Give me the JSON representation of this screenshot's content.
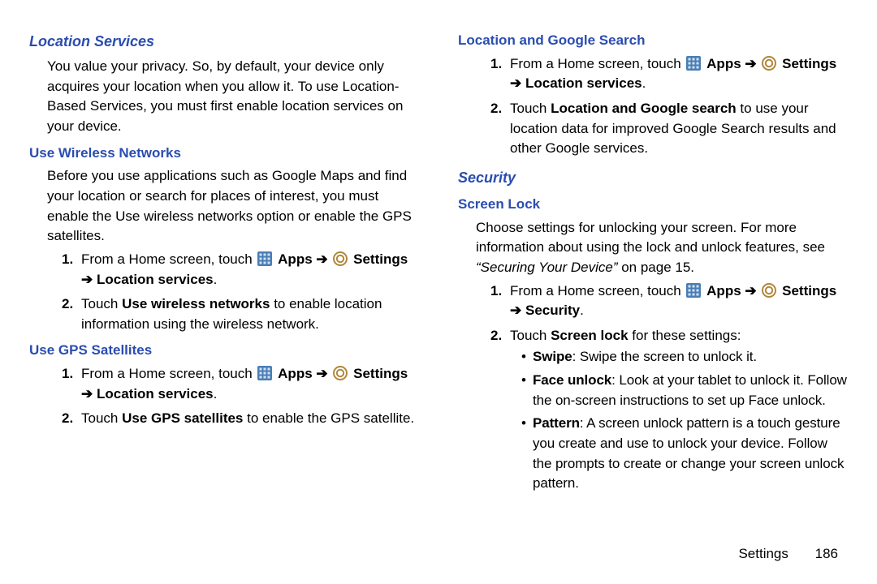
{
  "left": {
    "section_title": "Location Services",
    "intro": "You value your privacy. So, by default, your device only acquires your location when you allow it. To use Location-Based Services, you must first enable location services on your device.",
    "wireless": {
      "title": "Use Wireless Networks",
      "intro": "Before you use applications such as Google Maps and find your location or search for places of interest, you must enable the Use wireless networks option or enable the GPS satellites.",
      "step1_prefix": "From a Home screen, touch ",
      "apps_label": "Apps",
      "arrow": "➔",
      "settings_label": "Settings",
      "loc_services_label": "Location services",
      "step2_a": "Touch ",
      "step2_bold": "Use wireless networks",
      "step2_b": " to enable location information using the wireless network."
    },
    "gps": {
      "title": "Use GPS Satellites",
      "step1_prefix": "From a Home screen, touch ",
      "apps_label": "Apps",
      "arrow": "➔",
      "settings_label": "Settings",
      "loc_services_label": "Location services",
      "step2_a": "Touch ",
      "step2_bold": "Use GPS satellites",
      "step2_b": " to enable the GPS satellite."
    }
  },
  "right": {
    "lgs": {
      "title": "Location and Google Search",
      "step1_prefix": "From a Home screen, touch ",
      "apps_label": "Apps",
      "arrow": "➔",
      "settings_label": "Settings",
      "loc_services_label": "Location services",
      "step2_a": "Touch ",
      "step2_bold": "Location and Google search",
      "step2_b": " to use your location data for improved Google Search results and other Google services."
    },
    "security_title": "Security",
    "screenlock": {
      "title": "Screen Lock",
      "intro_a": "Choose settings for unlocking your screen. For more information about using the lock and unlock features, see ",
      "intro_italic": "“Securing Your Device”",
      "intro_b": " on page 15.",
      "step1_prefix": "From a Home screen, touch ",
      "apps_label": "Apps",
      "arrow": "➔",
      "settings_label": "Settings",
      "security_label": "Security",
      "step2_a": "Touch ",
      "step2_bold": "Screen lock",
      "step2_b": " for these settings:",
      "bullets": {
        "swipe_bold": "Swipe",
        "swipe_rest": ": Swipe the screen to unlock it.",
        "face_bold": "Face unlock",
        "face_rest": ": Look at your tablet to unlock it. Follow the on-screen instructions to set up Face unlock.",
        "pattern_bold": "Pattern",
        "pattern_rest": ": A screen unlock pattern is a touch gesture you create and use to unlock your device. Follow the prompts to create or change your screen unlock pattern."
      }
    }
  },
  "footer": {
    "label": "Settings",
    "page": "186"
  },
  "numbers": {
    "one": "1.",
    "two": "2."
  },
  "period": "."
}
